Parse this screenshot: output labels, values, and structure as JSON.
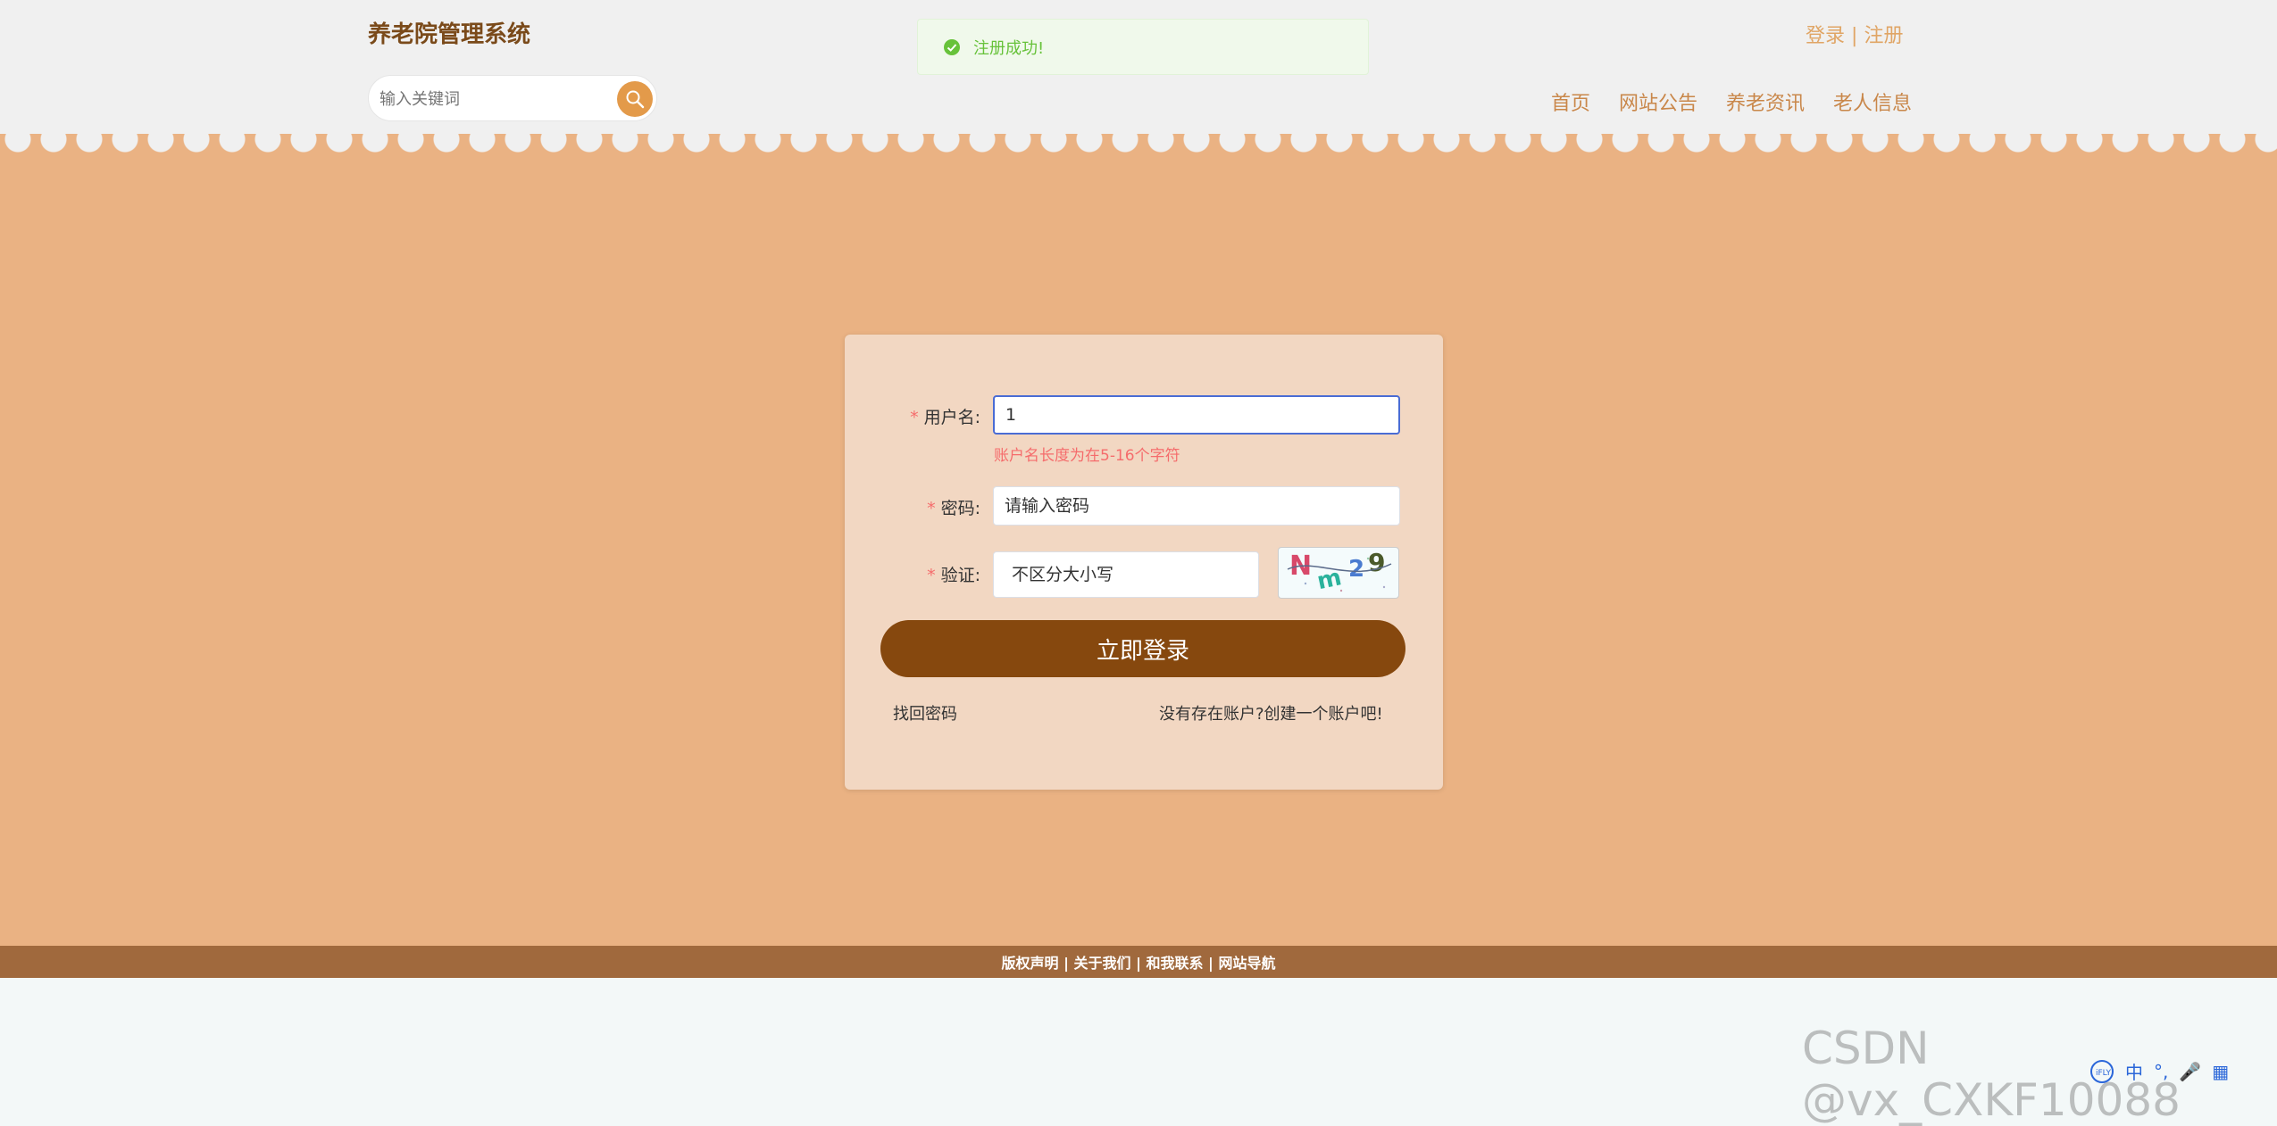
{
  "header": {
    "site_title": "养老院管理系统",
    "search": {
      "placeholder": "输入关键词"
    },
    "auth": {
      "login": "登录",
      "separator": "|",
      "register": "注册"
    },
    "nav": [
      "首页",
      "网站公告",
      "养老资讯",
      "老人信息"
    ]
  },
  "toast": {
    "message": "注册成功!",
    "type": "success"
  },
  "login_form": {
    "username": {
      "label": "用户名:",
      "value": "1",
      "error": "账户名长度为在5-16个字符"
    },
    "password": {
      "label": "密码:",
      "placeholder": "请输入密码"
    },
    "captcha": {
      "label": "验证:",
      "placeholder": "不区分大小写",
      "code": "Nm29"
    },
    "required_mark": "*",
    "submit_label": "立即登录",
    "forgot_password": "找回密码",
    "create_account": "没有存在账户?创建一个账户吧!"
  },
  "footer": {
    "links": "版权声明 | 关于我们 | 和我联系 | 网站导航"
  },
  "watermark": "CSDN @vx_CXKF10088",
  "ime": [
    "中",
    "°,",
    "🎤",
    "▦"
  ],
  "colors": {
    "main_bg": "#eab283",
    "header_bg": "#f0f0f0",
    "primary_button": "#86480e",
    "accent": "#e39a4a",
    "footer_bg": "#a0693d",
    "success": "#67c23a",
    "error": "#f56c6c"
  }
}
